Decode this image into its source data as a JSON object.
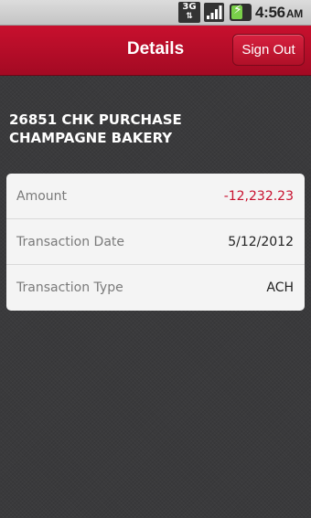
{
  "status_bar": {
    "network_label": "3G",
    "time": "4:56",
    "ampm": "AM"
  },
  "header": {
    "title": "Details",
    "signout_label": "Sign Out"
  },
  "transaction": {
    "title": "26851 CHK PURCHASE CHAMPAGNE BAKERY",
    "rows": [
      {
        "label": "Amount",
        "value": "-12,232.23"
      },
      {
        "label": "Transaction Date",
        "value": "5/12/2012"
      },
      {
        "label": "Transaction Type",
        "value": "ACH"
      }
    ]
  },
  "colors": {
    "brand_red": "#c8102e",
    "negative": "#c8102e",
    "battery": "#7ad04a"
  },
  "icons": [
    "network-3g-icon",
    "signal-icon",
    "battery-charging-icon"
  ]
}
